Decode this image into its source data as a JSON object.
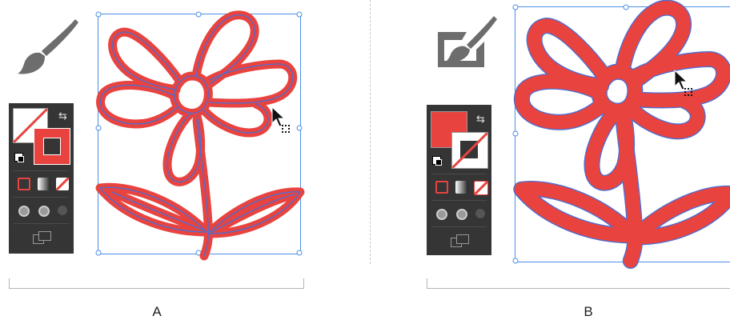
{
  "figure": {
    "panels": [
      {
        "id": "A",
        "caption": "A",
        "tool": "paintbrush-tool",
        "fill_state": "none",
        "stroke_state": "red"
      },
      {
        "id": "B",
        "caption": "B",
        "tool": "blob-brush-tool",
        "fill_state": "red",
        "stroke_state": "none"
      }
    ]
  },
  "colors": {
    "red": "#e8433f",
    "path_blue": "#4a6fd6",
    "panel_bg": "#353535",
    "icon_gray": "#6d6d6d"
  },
  "icons": {
    "paintbrush": "paintbrush-icon",
    "blob_brush": "blob-brush-icon",
    "cursor": "arrow-cursor-icon",
    "swap": "swap-arrows-icon",
    "default_colors": "default-colors-icon",
    "draw_modes": "draw-mode-icons",
    "screen_mode": "screen-mode-icon"
  }
}
